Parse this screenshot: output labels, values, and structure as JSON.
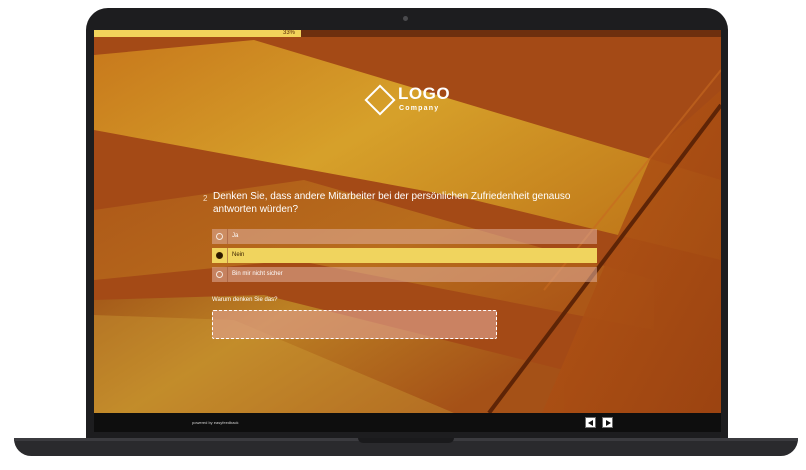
{
  "progress": {
    "percent": 33,
    "label": "33%"
  },
  "logo": {
    "title": "LOGO",
    "subtitle": "Company"
  },
  "question": {
    "number": "2",
    "text": "Denken Sie, dass andere Mitarbeiter bei der persönlichen Zufriedenheit genauso antworten würden?",
    "options": [
      {
        "label": "Ja",
        "selected": false
      },
      {
        "label": "Nein",
        "selected": true
      },
      {
        "label": "Bin mir nicht sicher",
        "selected": false
      }
    ]
  },
  "followup": {
    "label": "Warum denken Sie das?",
    "value": ""
  },
  "footer": {
    "powered_by": "powered by easyfeedback"
  },
  "colors": {
    "accent": "#f0d45e",
    "background": "#a44a16",
    "footer": "#0e0e0e"
  },
  "icons": {
    "logo": "diamond-logo-icon",
    "prev": "arrow-left-icon",
    "next": "arrow-right-icon"
  }
}
